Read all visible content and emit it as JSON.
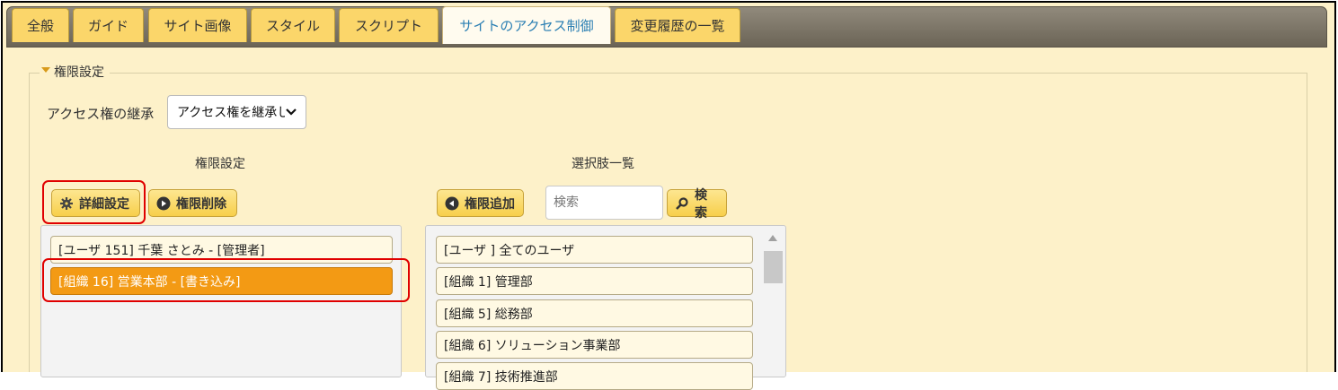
{
  "tabs": [
    {
      "label": "全般",
      "active": false
    },
    {
      "label": "ガイド",
      "active": false
    },
    {
      "label": "サイト画像",
      "active": false
    },
    {
      "label": "スタイル",
      "active": false
    },
    {
      "label": "スクリプト",
      "active": false
    },
    {
      "label": "サイトのアクセス制御",
      "active": true
    },
    {
      "label": "変更履歴の一覧",
      "active": false
    }
  ],
  "section": {
    "legend": "権限設定"
  },
  "inherit": {
    "label": "アクセス権の継承",
    "selected": "アクセス権を継承しない"
  },
  "left": {
    "heading": "権限設定",
    "detail_button": "詳細設定",
    "delete_button": "権限削除",
    "items": [
      "[ユーザ 151] 千葉 さとみ - [管理者]",
      "[組織 16] 営業本部 - [書き込み]"
    ]
  },
  "right": {
    "heading": "選択肢一覧",
    "add_button": "権限追加",
    "search_placeholder": "検索",
    "search_button": "検索",
    "items": [
      "[ユーザ ] 全てのユーザ",
      "[組織 1] 管理部",
      "[組織 5] 総務部",
      "[組織 6] ソリューション事業部",
      "[組織 7] 技術推進部"
    ]
  },
  "colors": {
    "accent": "#f39a14",
    "tab": "#fbd66a",
    "active_tab_text": "#2b7fb3",
    "highlight": "#e00000"
  }
}
